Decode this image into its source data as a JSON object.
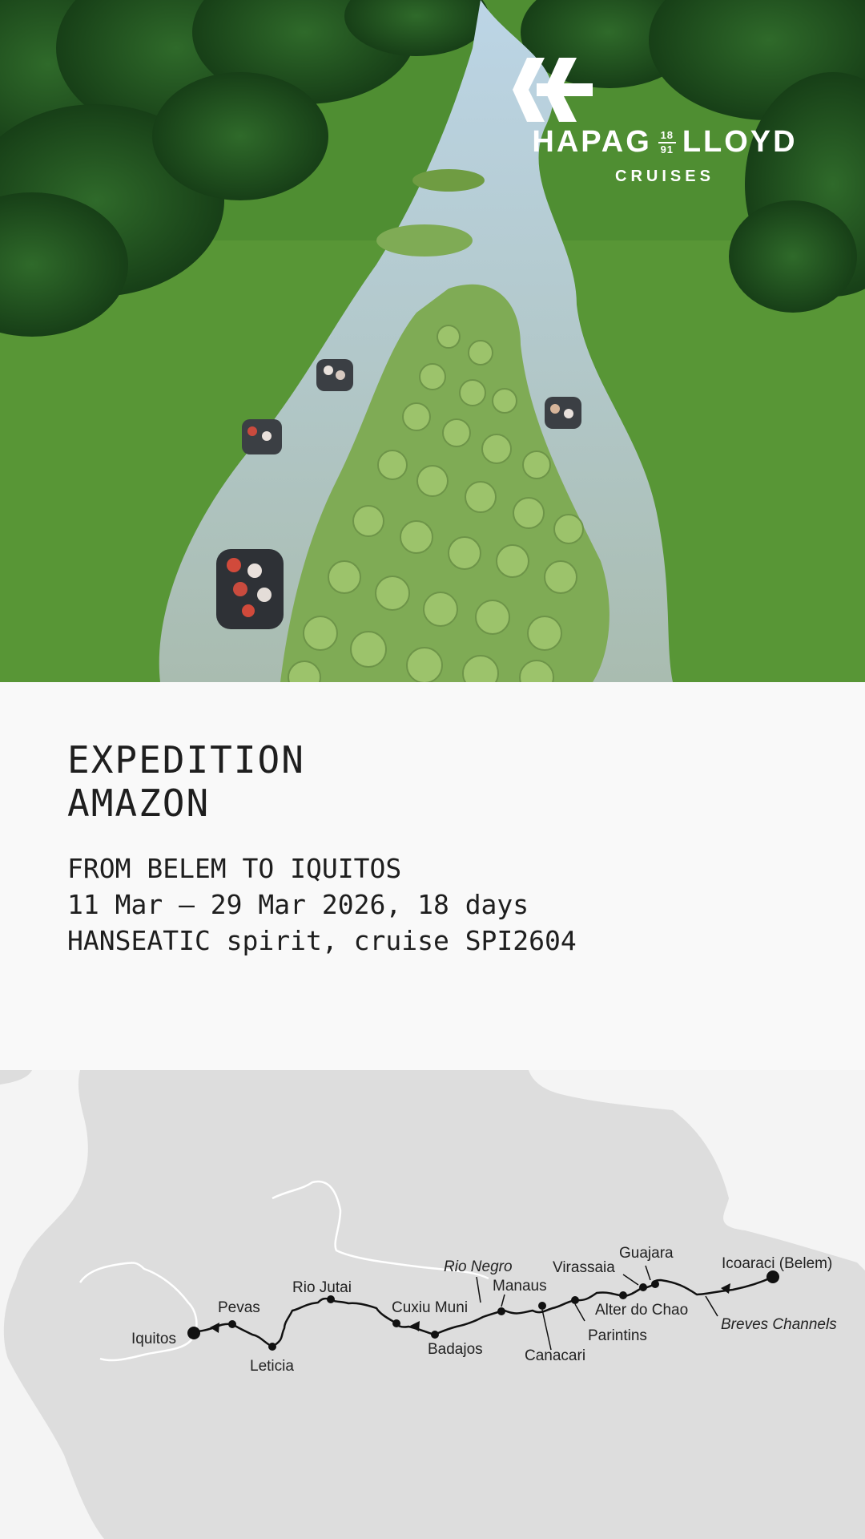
{
  "brand": {
    "name_left": "HAPAG",
    "year_top": "18",
    "year_bottom": "91",
    "name_right": "LLOYD",
    "sub": "CRUISES",
    "color": "#ffffff"
  },
  "hero": {
    "scene": "Aerial view of an Amazon river channel with giant water lilies and four expedition inflatable boats"
  },
  "expedition": {
    "title_line1": "EXPEDITION",
    "title_line2": "AMAZON",
    "route": "FROM BELEM TO IQUITOS",
    "dates": "11 Mar – 29 Mar 2026, 18 days",
    "ship": "HANSEATIC spirit, cruise SPI2604"
  },
  "map": {
    "land_color": "#dddddd",
    "water_color": "#f4f4f4",
    "route_color": "#111111",
    "labels": {
      "icoaraci": "Icoaraci (Belem)",
      "breves": "Breves Channels",
      "guajara": "Guajara",
      "virassaia": "Virassaia",
      "alter": "Alter do Chao",
      "parintins": "Parintins",
      "canacari": "Canacari",
      "manaus": "Manaus",
      "rionegro": "Rio Negro",
      "badajos": "Badajos",
      "cuxiu": "Cuxiu Muni",
      "riojutai": "Rio Jutai",
      "leticia": "Leticia",
      "pevas": "Pevas",
      "iquitos": "Iquitos"
    }
  }
}
